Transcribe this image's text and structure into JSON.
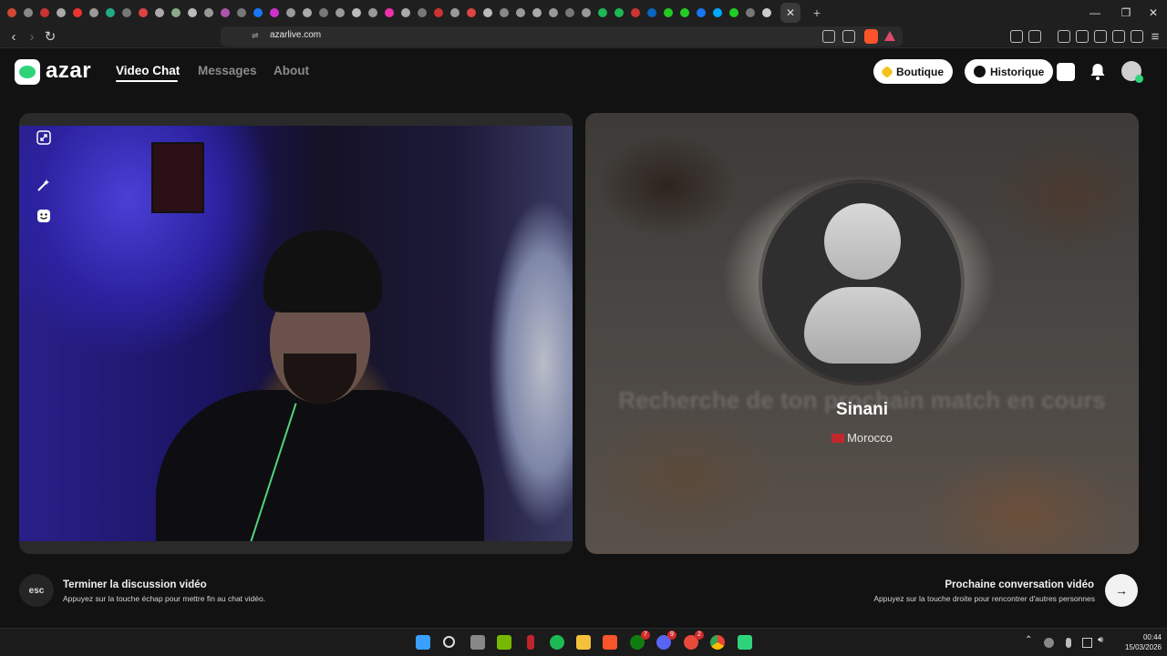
{
  "browser": {
    "url": "azarlive.com",
    "active_tab_close": "✕",
    "new_tab": "+"
  },
  "app": {
    "logo_text": "azar",
    "brand_color": "#2fd47a",
    "nav": [
      {
        "label": "Video Chat",
        "active": true
      },
      {
        "label": "Messages",
        "active": false
      },
      {
        "label": "About",
        "active": false
      }
    ],
    "boutique_label": "Boutique",
    "historique_label": "Historique"
  },
  "peer": {
    "name": "Sinani",
    "country": "Morocco",
    "searching_text": "Recherche de ton prochain match en cours"
  },
  "footer": {
    "esc_key": "esc",
    "end_title": "Terminer la discussion vidéo",
    "end_sub": "Appuyez sur la touche échap pour mettre fin au chat vidéo.",
    "next_title": "Prochaine conversation vidéo",
    "next_sub": "Appuyez sur la touche droite pour rencontrer d'autres personnes",
    "next_icon": "→"
  },
  "taskbar": {
    "time": "00:44",
    "date": "15/03/2026",
    "badges": {
      "xbox": "7",
      "discord": "9",
      "game": "2"
    }
  },
  "icons": {
    "expand": "expand-icon",
    "magic_wand": "magic-wand-icon",
    "sticker": "sticker-icon"
  }
}
